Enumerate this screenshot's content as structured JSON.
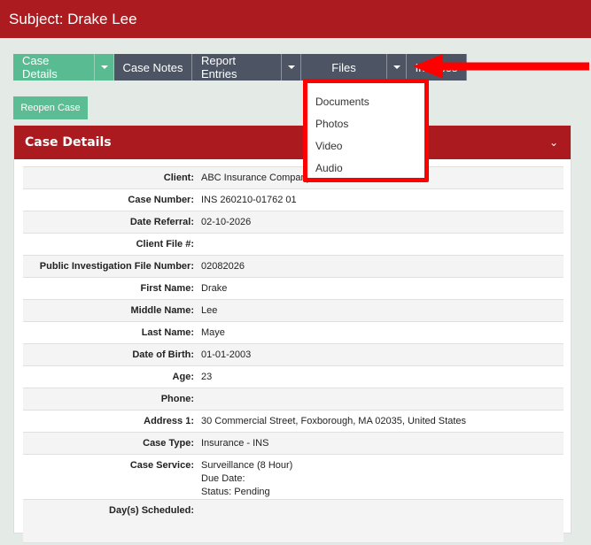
{
  "header": {
    "title": "Subject: Drake Lee"
  },
  "toolbar": {
    "case_details": "Case Details",
    "case_notes": "Case Notes",
    "report_entries": "Report Entries",
    "files": "Files",
    "hidden_label": "Invoices"
  },
  "reopen_label": "Reopen Case",
  "panel": {
    "title": "Case Details"
  },
  "files_menu": [
    "Documents",
    "Photos",
    "Video",
    "Audio"
  ],
  "details": [
    {
      "label": "Client:",
      "value": "ABC Insurance Company"
    },
    {
      "label": "Case Number:",
      "value": "INS 260210-01762 01"
    },
    {
      "label": "Date Referral:",
      "value": "02-10-2026"
    },
    {
      "label": "Client File #:",
      "value": ""
    },
    {
      "label": "Public Investigation File Number:",
      "value": "02082026"
    },
    {
      "label": "First Name:",
      "value": "Drake"
    },
    {
      "label": "Middle Name:",
      "value": "Lee"
    },
    {
      "label": "Last Name:",
      "value": "Maye"
    },
    {
      "label": "Date of Birth:",
      "value": "01-01-2003"
    },
    {
      "label": "Age:",
      "value": "23"
    },
    {
      "label": "Phone:",
      "value": ""
    },
    {
      "label": "Address 1:",
      "value": "30 Commercial Street, Foxborough, MA 02035, United States"
    },
    {
      "label": "Case Type:",
      "value": "Insurance - INS"
    },
    {
      "label": "Case Service:",
      "lines": [
        "Surveillance (8 Hour)",
        "Due Date:",
        "Status: Pending"
      ]
    },
    {
      "label": "Day(s) Scheduled:",
      "value": ""
    }
  ],
  "colors": {
    "header_red": "#ac1b20",
    "accent_green": "#59bb92",
    "dark_button": "#4d5564",
    "highlight": "#ff0000"
  }
}
